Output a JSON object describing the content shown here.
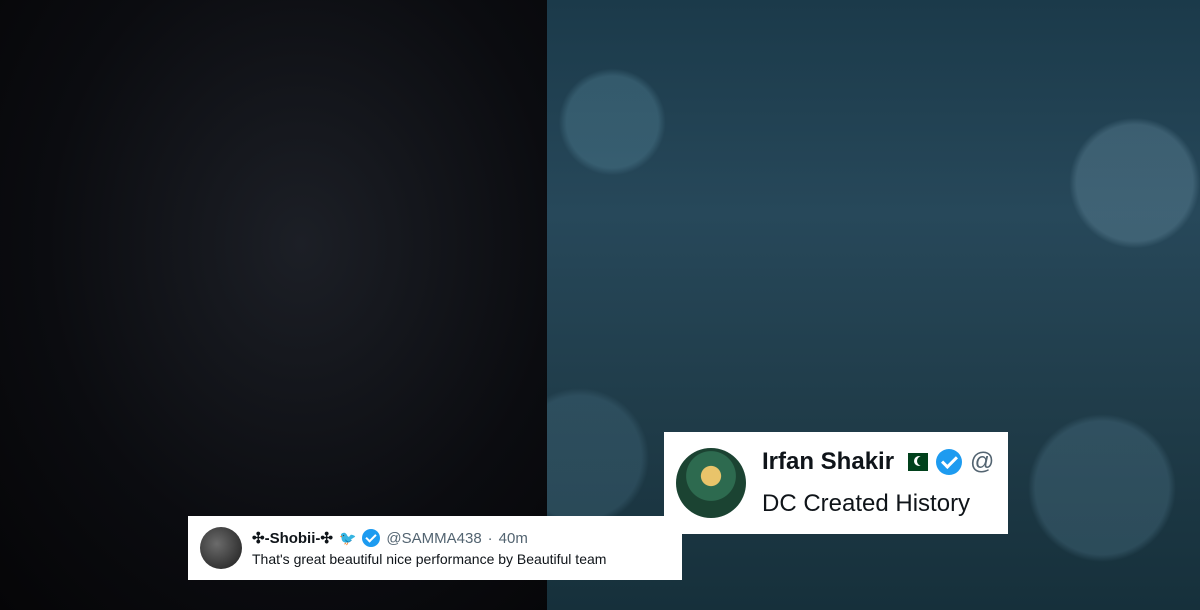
{
  "tweet_small": {
    "display_name": "✣-Shobii-✣",
    "handle": "@SAMMA438",
    "separator": "·",
    "time": "40m",
    "text": "That's great beautiful nice performance by Beautiful team",
    "twitter_glyph": "🐦"
  },
  "tweet_big": {
    "display_name": "Irfan Shakir",
    "handle_partial": "@",
    "text": "DC Created History"
  },
  "icons": {
    "verified": "verified-badge-icon",
    "flag": "pakistan-flag-icon"
  },
  "colors": {
    "verified_blue": "#1d9bf0",
    "text_primary": "#0f1419",
    "text_secondary": "#536471"
  }
}
